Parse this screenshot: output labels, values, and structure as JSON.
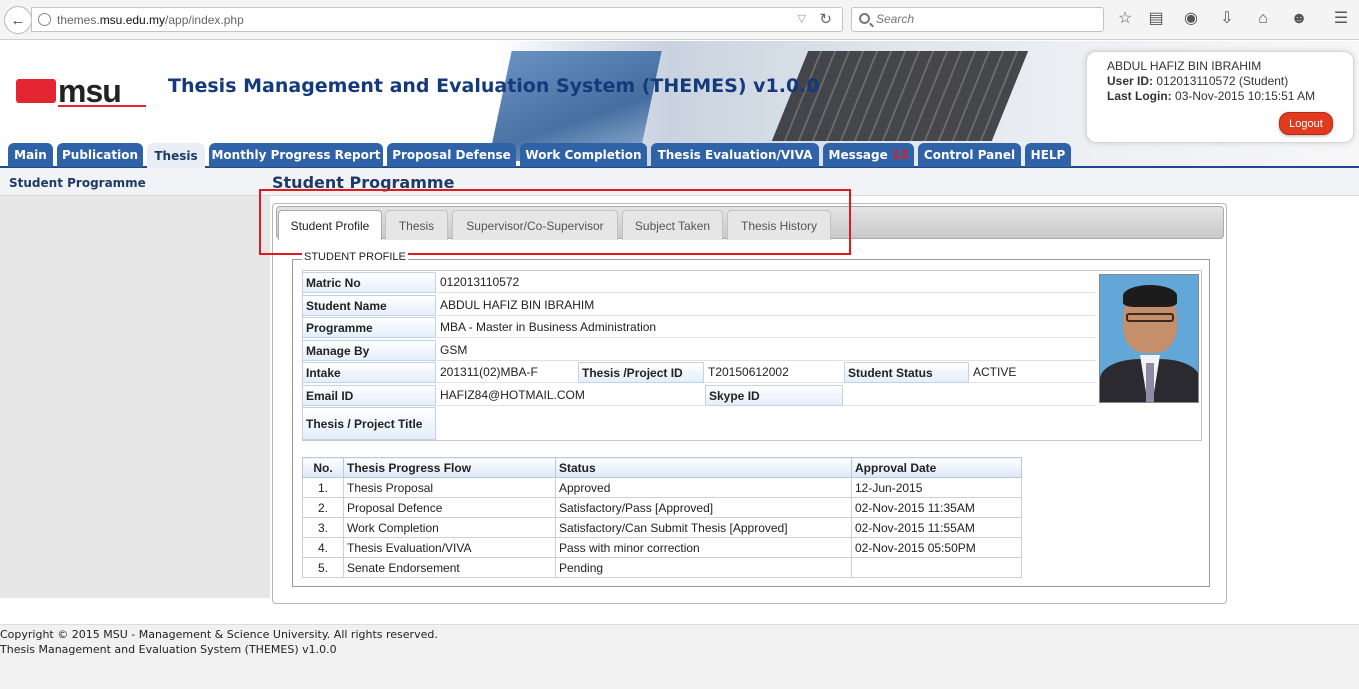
{
  "browser": {
    "url_prefix": "themes.",
    "url_domain": "msu.edu.my",
    "url_path": "/app/index.php",
    "search_placeholder": "Search"
  },
  "header": {
    "logo_text": "msu",
    "title": "Thesis Management and Evaluation System (THEMES) v1.0.0"
  },
  "user": {
    "name": "ABDUL HAFIZ BIN IBRAHIM",
    "user_id_label": "User ID:",
    "user_id_value": "012013110572 (Student)",
    "last_login_label": "Last Login:",
    "last_login_value": "03-Nov-2015 10:15:51 AM",
    "logout_label": "Logout"
  },
  "nav": {
    "tabs": [
      {
        "label": "Main"
      },
      {
        "label": "Publication"
      },
      {
        "label": "Thesis"
      },
      {
        "label": "Monthly Progress Report"
      },
      {
        "label": "Proposal Defense"
      },
      {
        "label": "Work Completion"
      },
      {
        "label": "Thesis Evaluation/VIVA"
      },
      {
        "label": "Message"
      },
      {
        "label": "Control Panel"
      },
      {
        "label": "HELP"
      }
    ],
    "message_count": "13",
    "active_tab": "Thesis"
  },
  "sidebar": {
    "items": [
      {
        "label": "Student Programme"
      }
    ]
  },
  "page": {
    "title": "Student Programme",
    "tabs": [
      {
        "label": "Student Profile"
      },
      {
        "label": "Thesis"
      },
      {
        "label": "Supervisor/Co-Supervisor"
      },
      {
        "label": "Subject Taken"
      },
      {
        "label": "Thesis History"
      }
    ],
    "active_tab": "Student Profile",
    "section_legend": "STUDENT PROFILE"
  },
  "profile": {
    "matric_label": "Matric No",
    "matric_value": "012013110572",
    "name_label": "Student Name",
    "name_value": "ABDUL HAFIZ BIN IBRAHIM",
    "programme_label": "Programme",
    "programme_value": "MBA - Master in Business Administration",
    "manage_label": "Manage By",
    "manage_value": "GSM",
    "intake_label": "Intake",
    "intake_value": "201311(02)MBA-F",
    "project_id_label": "Thesis /Project ID",
    "project_id_value": "T20150612002",
    "status_label": "Student Status",
    "status_value": "ACTIVE",
    "email_label": "Email ID",
    "email_value": "HAFIZ84@HOTMAIL.COM",
    "skype_label": "Skype ID",
    "skype_value": "",
    "title_label": "Thesis / Project Title",
    "title_value": ""
  },
  "progress": {
    "headers": [
      "No.",
      "Thesis Progress Flow",
      "Status",
      "Approval Date"
    ],
    "rows": [
      {
        "no": "1.",
        "flow": "Thesis Proposal",
        "status": "Approved",
        "date": "12-Jun-2015"
      },
      {
        "no": "2.",
        "flow": "Proposal Defence",
        "status": "Satisfactory/Pass [Approved]",
        "date": "02-Nov-2015 11:35AM"
      },
      {
        "no": "3.",
        "flow": "Work Completion",
        "status": "Satisfactory/Can Submit Thesis [Approved]",
        "date": "02-Nov-2015 11:55AM"
      },
      {
        "no": "4.",
        "flow": "Thesis Evaluation/VIVA",
        "status": "Pass with minor correction",
        "date": "02-Nov-2015 05:50PM"
      },
      {
        "no": "5.",
        "flow": "Senate Endorsement",
        "status": "Pending",
        "date": ""
      }
    ]
  },
  "footer": {
    "copyright": "Copyright © 2015 MSU - Management & Science University. All rights reserved.",
    "system": "Thesis Management and Evaluation System (THEMES) v1.0.0"
  }
}
